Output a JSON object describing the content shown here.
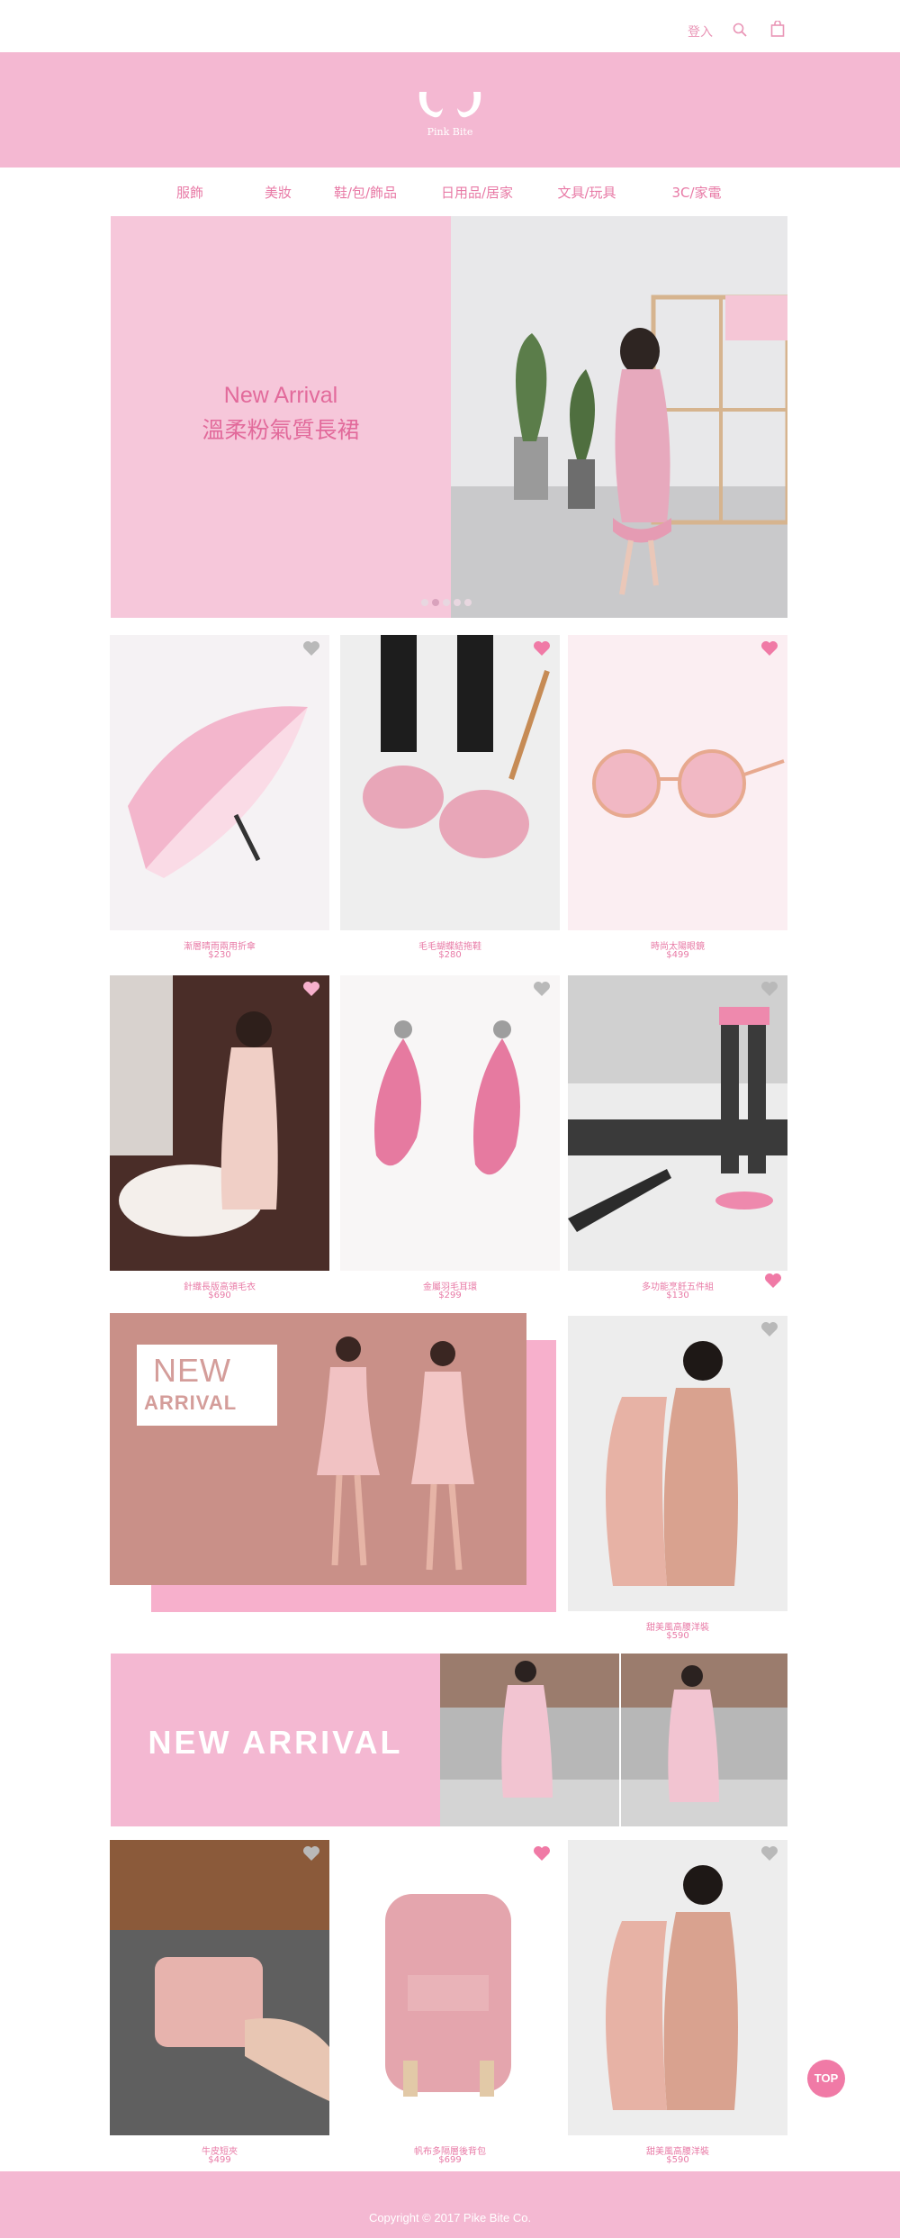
{
  "topbar": {
    "login_label": "登入",
    "search_icon": "search-icon",
    "cart_icon": "shopping-bag-icon"
  },
  "brand": {
    "logo_text": "Pink Bite",
    "accent_color": "#f4b8d2",
    "text_color": "#e87aa6"
  },
  "nav": {
    "items": [
      {
        "label": "服飾"
      },
      {
        "label": "美妝"
      },
      {
        "label": "鞋/包/飾品"
      },
      {
        "label": "日用品/居家"
      },
      {
        "label": "文具/玩具"
      },
      {
        "label": "3C/家電"
      }
    ]
  },
  "hero": {
    "title_en": "New Arrival",
    "title_zh": "溫柔粉氣質長裙",
    "slide_count": 5,
    "active_slide": 2
  },
  "products": [
    {
      "name": "漸層晴雨兩用折傘",
      "price": "$230",
      "favorited": false
    },
    {
      "name": "毛毛蝴蝶結拖鞋",
      "price": "$280",
      "favorited": true
    },
    {
      "name": "時尚太陽眼鏡",
      "price": "$499",
      "favorited": true
    },
    {
      "name": "針織長版高領毛衣",
      "price": "$690",
      "favorited": true
    },
    {
      "name": "金屬羽毛耳環",
      "price": "$299",
      "favorited": false
    },
    {
      "name": "多功能烹飪五件組",
      "price": "$130",
      "favorited": true
    },
    {
      "name": "甜美風高腰洋裝",
      "price": "$590",
      "favorited": false
    },
    {
      "name": "牛皮短夾",
      "price": "$499",
      "favorited": false
    },
    {
      "name": "帆布多隔層後背包",
      "price": "$699",
      "favorited": true
    },
    {
      "name": "甜美風高腰洋裝",
      "price": "$590",
      "favorited": false
    }
  ],
  "feature": {
    "new": "NEW",
    "arrival": "ARRIVAL"
  },
  "strip": {
    "text": "NEW ARRIVAL"
  },
  "top_button": {
    "label": "TOP"
  },
  "footer": {
    "copyright": "Copyright © 2017 Pike Bite Co."
  }
}
